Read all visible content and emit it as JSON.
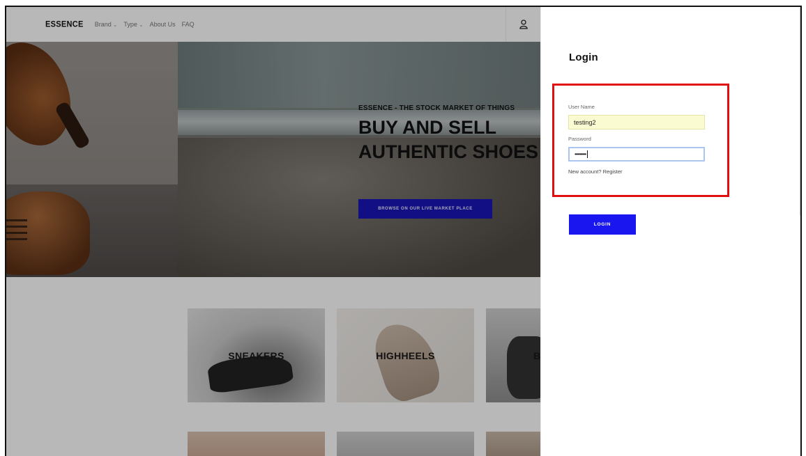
{
  "header": {
    "logo": "ESSENCE",
    "nav": [
      {
        "label": "Brand",
        "dropdown": true
      },
      {
        "label": "Type",
        "dropdown": true
      },
      {
        "label": "About Us",
        "dropdown": false
      },
      {
        "label": "FAQ",
        "dropdown": false
      }
    ],
    "user_icon": "user-icon"
  },
  "hero": {
    "kicker": "ESSENCE - THE STOCK MARKET OF THINGS",
    "title_line1": "BUY AND SELL",
    "title_line2": "AUTHENTIC SHOES",
    "cta": "BROWSE ON OUR LIVE MARKET PLACE"
  },
  "categories": [
    {
      "label": "SNEAKERS"
    },
    {
      "label": "HIGHHEELS"
    },
    {
      "label": "BOOTS"
    }
  ],
  "login": {
    "title": "Login",
    "username_label": "User Name",
    "username_value": "testing2",
    "password_label": "Password",
    "password_value": "•••••••••",
    "register_text": "New account? Register",
    "submit_label": "LOGIN"
  },
  "colors": {
    "accent": "#1a16f0",
    "highlight_box": "#e01010",
    "autofill": "#fafbd0"
  }
}
